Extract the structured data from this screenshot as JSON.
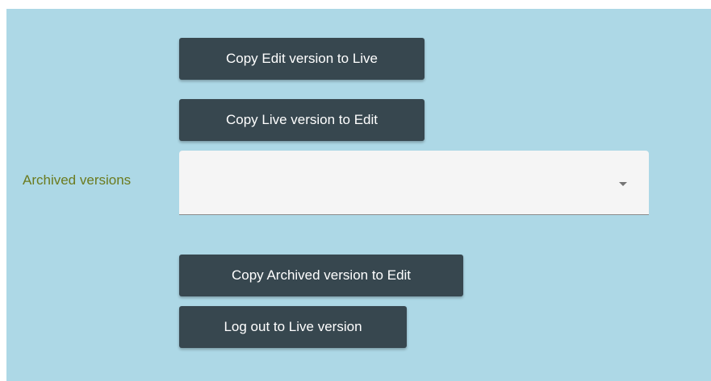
{
  "buttons": {
    "copy_edit_to_live": "Copy Edit version to Live",
    "copy_live_to_edit": "Copy Live version to Edit",
    "copy_archived_to_edit": "Copy Archived version to Edit",
    "logout_to_live": "Log out to Live version"
  },
  "archived": {
    "label": "Archived versions",
    "selected_value": ""
  },
  "icons": {
    "dropdown": "chevron-down-icon"
  },
  "colors": {
    "background": "#add8e6",
    "button": "#37474f",
    "label": "#6b7a1e"
  }
}
